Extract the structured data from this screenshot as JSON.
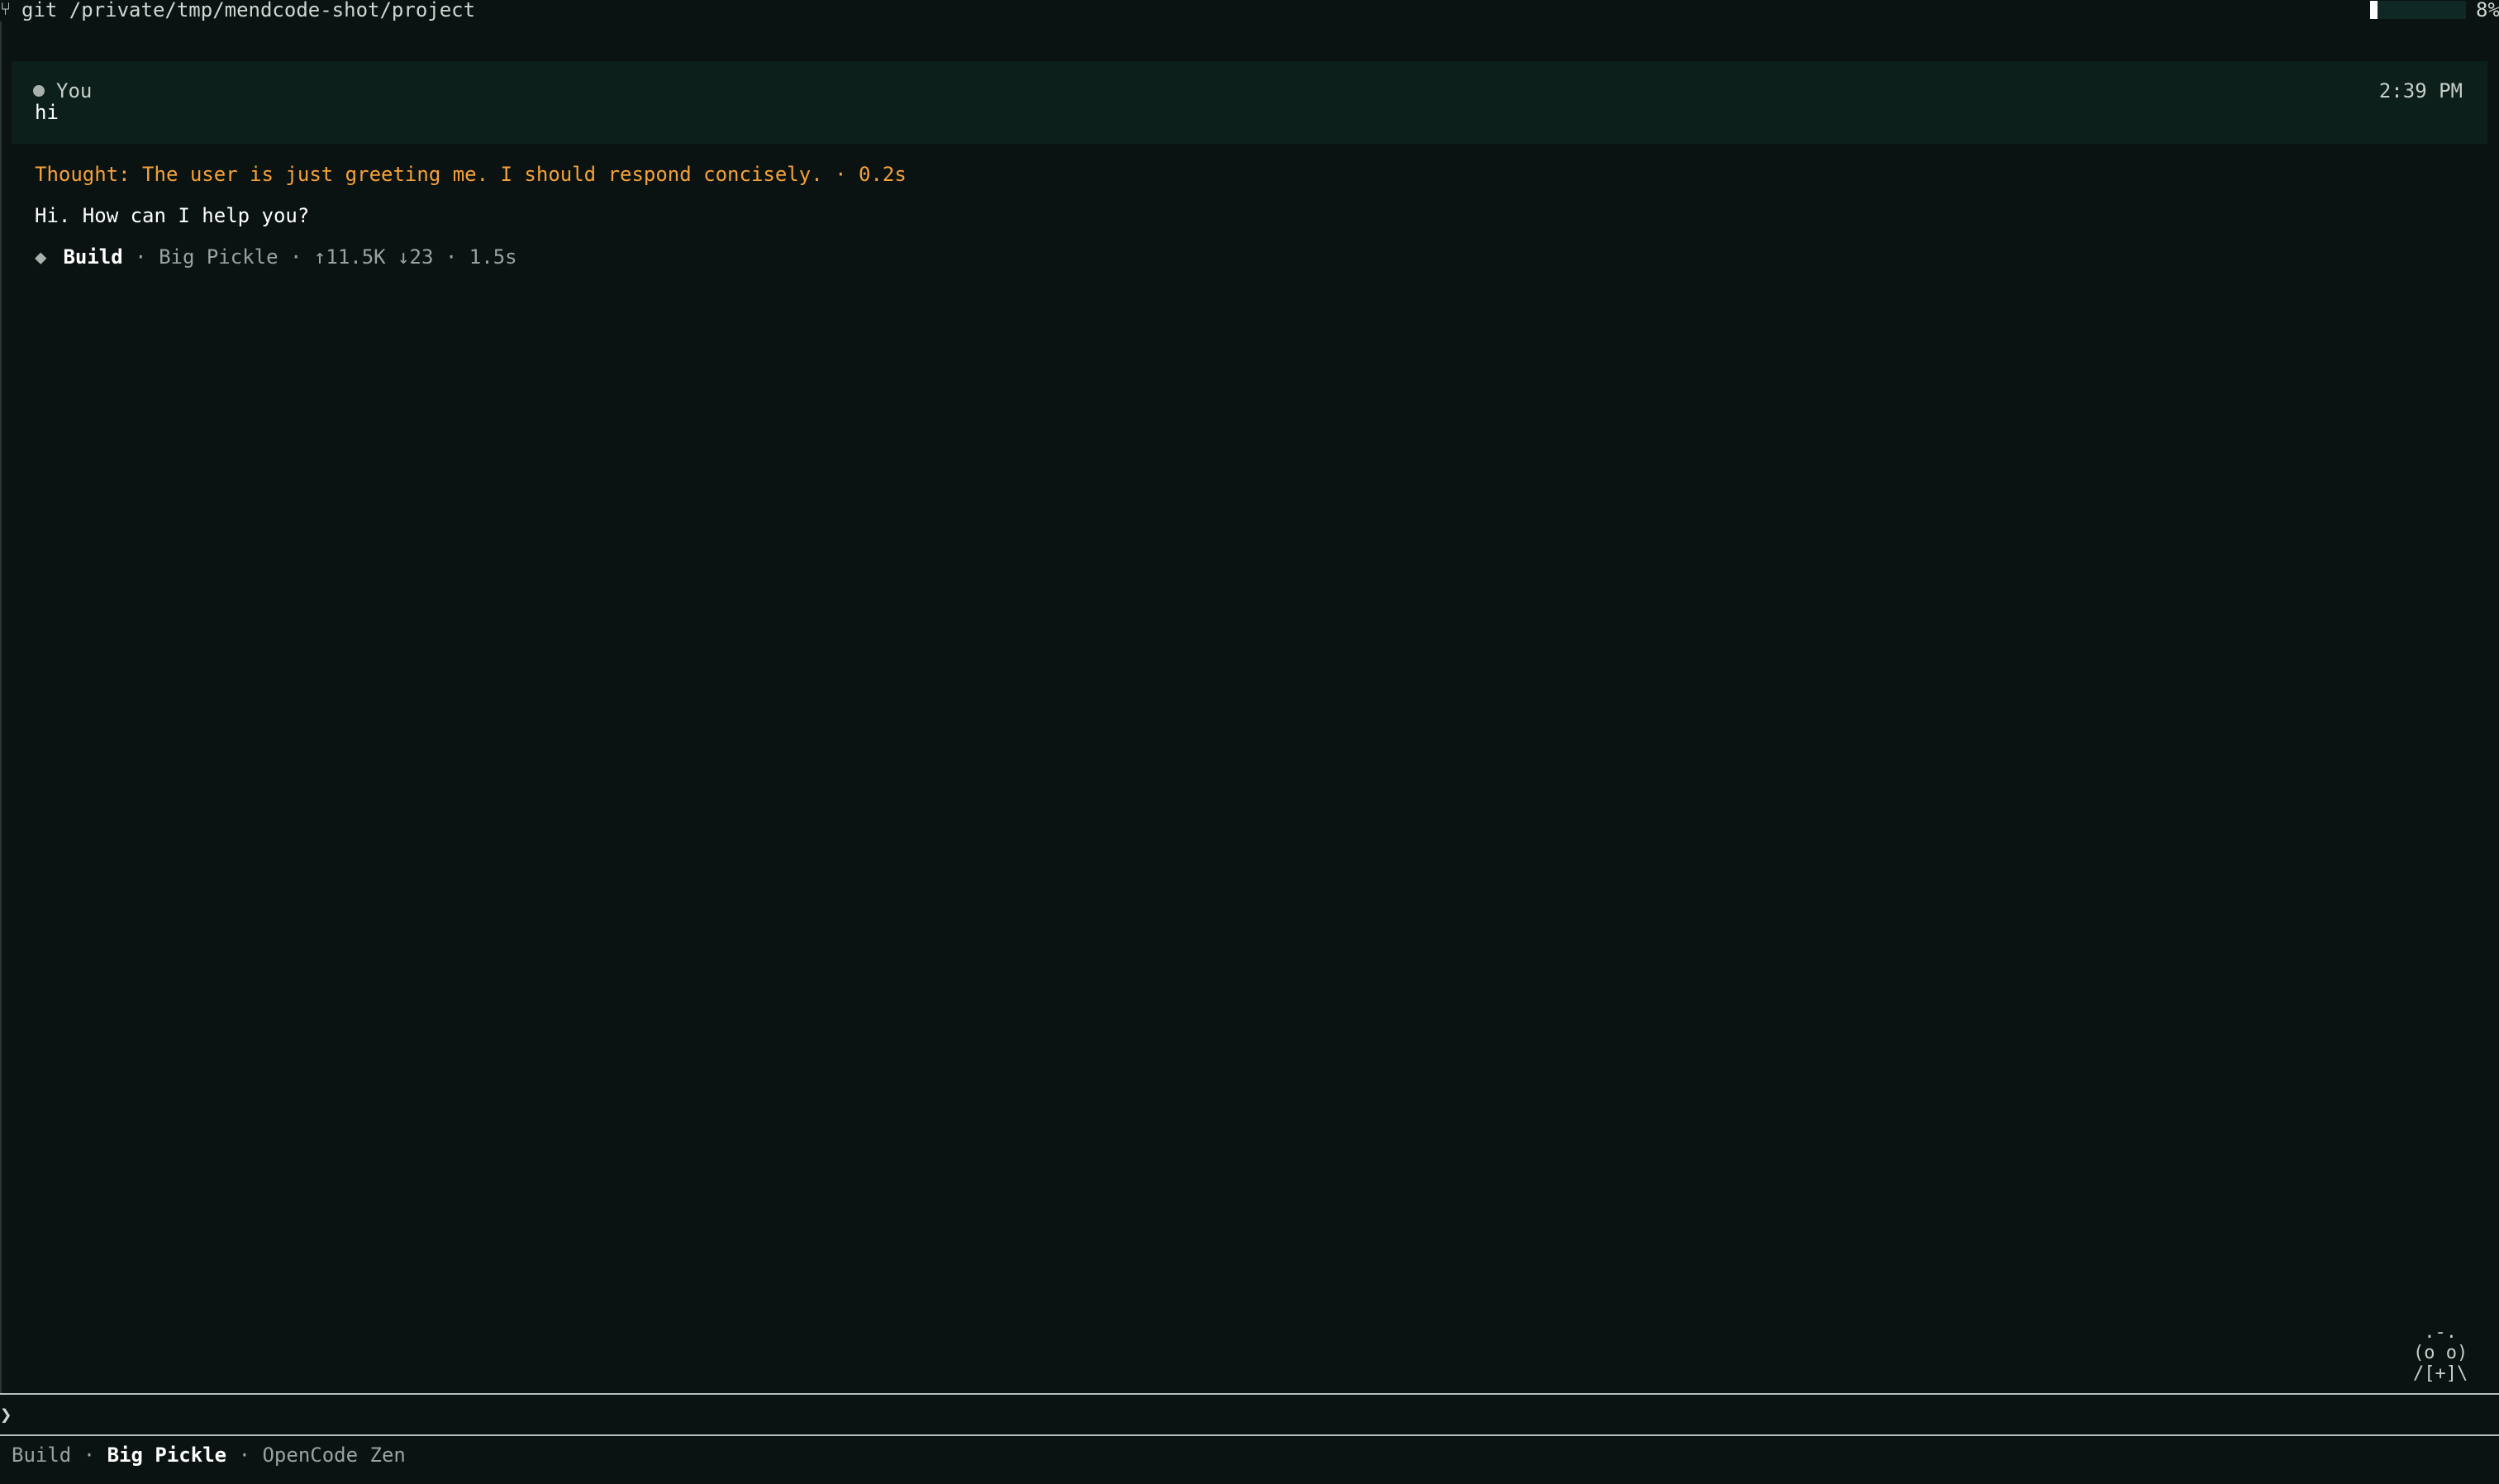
{
  "topbar": {
    "branch_icon": "⑂",
    "path": "git /private/tmp/mendcode-shot/project",
    "context_fraction": 0.08,
    "context_percent": "8%"
  },
  "user_message": {
    "author": "You",
    "text": "hi",
    "time": "2:39 PM"
  },
  "assistant": {
    "thought": "Thought: The user is just greeting me. I should respond concisely. · 0.2s",
    "reply": "Hi. How can I help you?",
    "meta": {
      "icon": "◆",
      "agent": "Build",
      "model": "Big Pickle",
      "tokens_up": "↑11.5K",
      "tokens_down": "↓23",
      "duration": "1.5s",
      "separator": "·"
    }
  },
  "mascot": {
    "art": " .-.\n(o o)\n/[+]\\"
  },
  "prompt": {
    "caret": "❯",
    "value": "",
    "placeholder": ""
  },
  "footer": {
    "agent": "Build",
    "model": "Big Pickle",
    "provider": "OpenCode Zen",
    "separator": "·"
  },
  "colors": {
    "background": "#0a1312",
    "user_block": "#0c1f1b",
    "thought": "#f5a13a",
    "text": "#ffffff",
    "muted": "#9aa3a0"
  }
}
